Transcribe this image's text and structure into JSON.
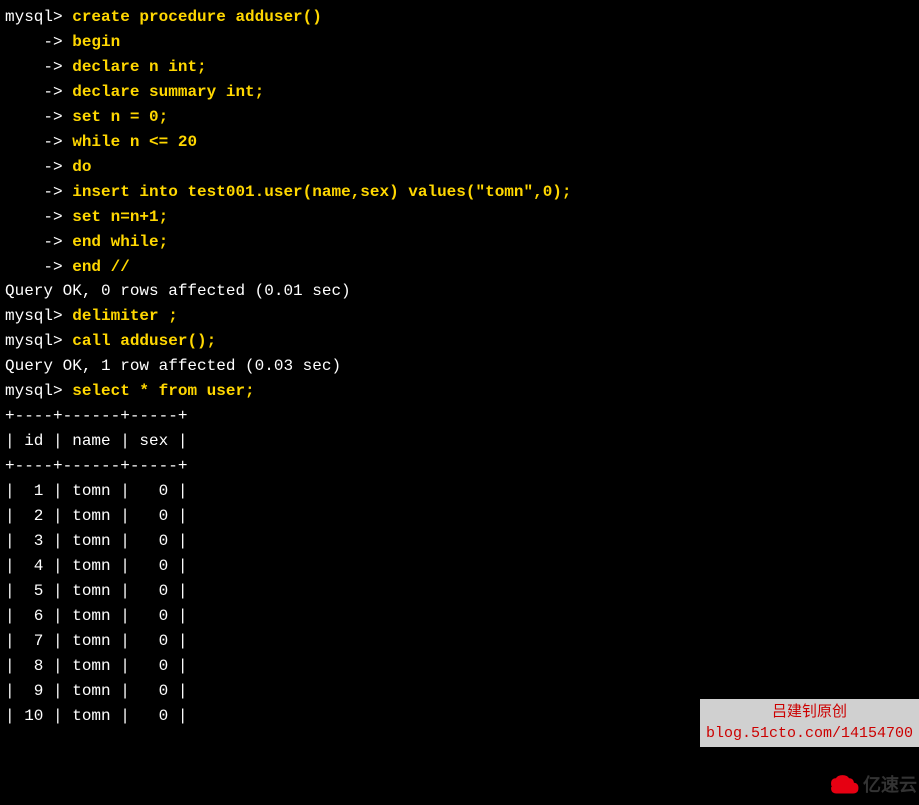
{
  "terminal": {
    "prompts": {
      "mysql": "mysql> ",
      "continuation": "    -> "
    },
    "lines": [
      {
        "prompt": "mysql",
        "cmd": "create procedure adduser()"
      },
      {
        "prompt": "cont",
        "cmd": "begin"
      },
      {
        "prompt": "cont",
        "cmd": "declare n int;"
      },
      {
        "prompt": "cont",
        "cmd": "declare summary int;"
      },
      {
        "prompt": "cont",
        "cmd": "set n = 0;"
      },
      {
        "prompt": "cont",
        "cmd": "while n <= 20"
      },
      {
        "prompt": "cont",
        "cmd": "do"
      },
      {
        "prompt": "cont",
        "cmd": "insert into test001.user(name,sex) values(\"tomn\",0);"
      },
      {
        "prompt": "cont",
        "cmd": "set n=n+1;"
      },
      {
        "prompt": "cont",
        "cmd": "end while;"
      },
      {
        "prompt": "cont",
        "cmd": "end //"
      }
    ],
    "result1": "Query OK, 0 rows affected (0.01 sec)",
    "blank1": "",
    "line_delim_prompt": "mysql> ",
    "line_delim_cmd": "delimiter ;",
    "line_call_prompt": "mysql> ",
    "line_call_cmd": "call adduser();",
    "result2": "Query OK, 1 row affected (0.03 sec)",
    "blank2": "",
    "line_select_prompt": "mysql> ",
    "line_select_cmd": "select * from user;",
    "table": {
      "border": "+----+------+-----+",
      "header": "| id | name | sex |",
      "rows": [
        "|  1 | tomn |   0 |",
        "|  2 | tomn |   0 |",
        "|  3 | tomn |   0 |",
        "|  4 | tomn |   0 |",
        "|  5 | tomn |   0 |",
        "|  6 | tomn |   0 |",
        "|  7 | tomn |   0 |",
        "|  8 | tomn |   0 |",
        "|  9 | tomn |   0 |",
        "| 10 | tomn |   0 |"
      ]
    }
  },
  "watermark1": {
    "title": "吕建钊原创",
    "url": "blog.51cto.com/14154700"
  },
  "watermark2": {
    "text": "亿速云"
  }
}
